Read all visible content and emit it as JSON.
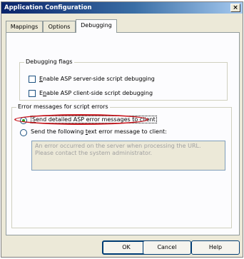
{
  "window": {
    "title": "Application Configuration",
    "close_glyph": "×"
  },
  "tabs": [
    {
      "label": "Mappings"
    },
    {
      "label": "Options"
    },
    {
      "label": "Debugging",
      "selected": true
    }
  ],
  "debugging_flags": {
    "group_label": "Debugging flags",
    "server_side": {
      "access_key": "E",
      "rest": "nable ASP server-side script debugging",
      "checked": false
    },
    "client_side": {
      "prefix": "E",
      "access_key": "n",
      "rest": "able ASP client-side script debugging",
      "checked": false
    }
  },
  "error_messages": {
    "group_label": "Error messages for script errors",
    "detailed": {
      "access_key": "S",
      "rest": "end detailed ASP error messages to client",
      "selected": true
    },
    "custom": {
      "prefix": "Send the following ",
      "access_key": "t",
      "rest": "ext error message to client:",
      "selected": false
    },
    "custom_text": "An error occurred on the server when processing the URL.\nPlease contact the system administrator."
  },
  "buttons": {
    "ok": "OK",
    "cancel": "Cancel",
    "help": "Help"
  },
  "colors": {
    "highlight_ellipse": "#c8161d",
    "titlebar": "#0a246a",
    "radio_dot": "#21a121"
  }
}
